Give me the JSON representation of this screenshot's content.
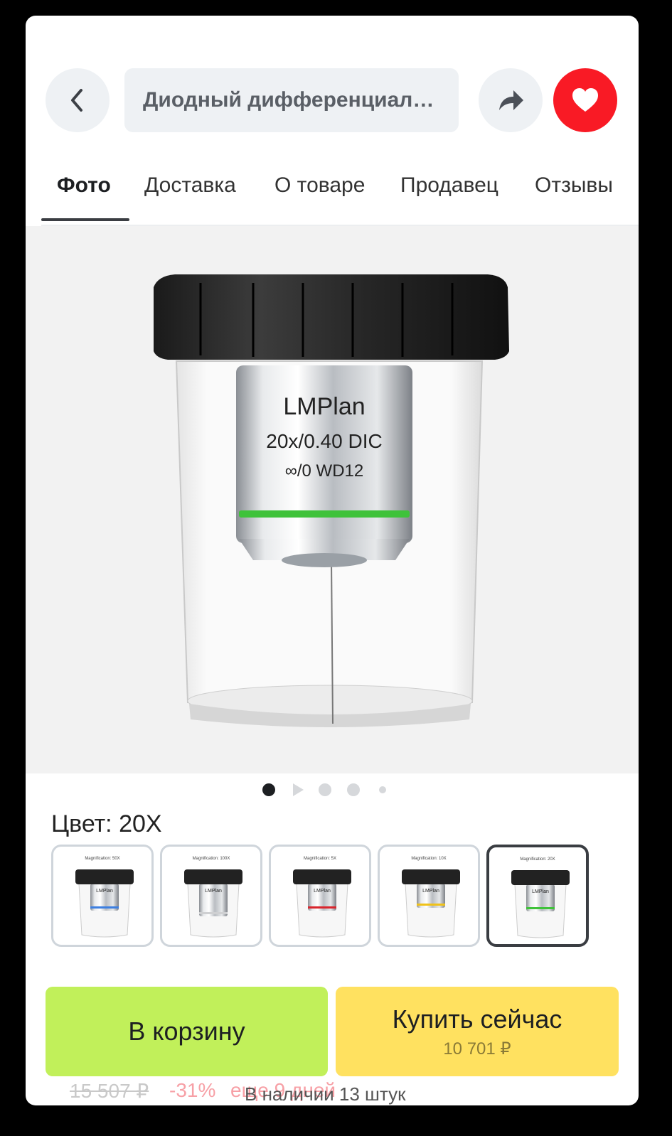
{
  "header": {
    "search_text": "Диодный дифференциаль...",
    "favorite_color": "#f91a25"
  },
  "tabs": [
    {
      "label": "Фото",
      "active": true
    },
    {
      "label": "Доставка",
      "active": false
    },
    {
      "label": "О товаре",
      "active": false
    },
    {
      "label": "Продавец",
      "active": false
    },
    {
      "label": "Отзывы",
      "active": false
    }
  ],
  "hero": {
    "lens_text_line1": "LMPlan",
    "lens_text_line2": "20x/0.40 DIC",
    "lens_text_line3": "∞/0 WD12",
    "ring_color": "#3fc23a"
  },
  "gallery": {
    "total": 5,
    "current": 1
  },
  "variant": {
    "label": "Цвет: 20X",
    "options": [
      {
        "mag_label": "Magnification: 50X",
        "ring_color": "#3d7fe0",
        "selected": false
      },
      {
        "mag_label": "Magnification: 100X",
        "ring_color": "#d8d8d8",
        "selected": false
      },
      {
        "mag_label": "Magnification: 5X",
        "ring_color": "#d9252d",
        "selected": false
      },
      {
        "mag_label": "Magnification: 10X",
        "ring_color": "#f0c21a",
        "selected": false
      },
      {
        "mag_label": "Magnification: 20X",
        "ring_color": "#3fc23a",
        "selected": true
      }
    ]
  },
  "actions": {
    "cart_label": "В корзину",
    "buy_label": "Купить сейчас",
    "buy_price": "10 701 ₽"
  },
  "footer": {
    "old_price": "15 507 ₽",
    "discount": "-31%",
    "promo": "еще 9 дней",
    "stock": "В наличии 13 штук"
  }
}
